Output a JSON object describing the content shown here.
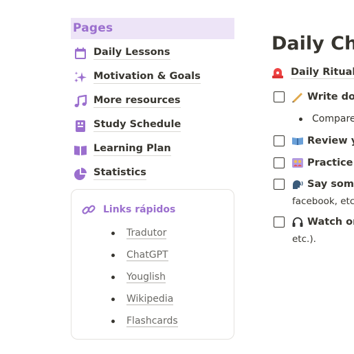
{
  "sidebar": {
    "header": "Pages",
    "items": [
      {
        "label": "Daily Lessons",
        "icon": "calendar-icon"
      },
      {
        "label": "Motivation & Goals",
        "icon": "sparkles-icon"
      },
      {
        "label": "More resources",
        "icon": "music-note-icon"
      },
      {
        "label": "Study Schedule",
        "icon": "schedule-icon"
      },
      {
        "label": "Learning Plan",
        "icon": "book-open-icon"
      },
      {
        "label": "Statistics",
        "icon": "pie-chart-icon"
      }
    ],
    "links": {
      "title": "Links rápidos",
      "icon": "link-icon",
      "items": [
        "Tradutor",
        "ChatGPT",
        "Youglish",
        "Wikipedia",
        "Flashcards"
      ]
    }
  },
  "main": {
    "title": "Daily Cha",
    "ritual": {
      "label": "Daily Ritual",
      "icon": "siren-icon"
    },
    "todos": [
      {
        "text": "Write dow",
        "icon": "writing-hand-icon"
      },
      {
        "text": "Review yo",
        "icon": "book-icon"
      },
      {
        "text": "Practice w",
        "icon": "people-icon"
      },
      {
        "text": "Say somet",
        "icon": "speaking-head-icon",
        "continuation": "facebook, etc"
      },
      {
        "text": "Watch or",
        "icon": "headphones-icon",
        "continuation": "etc.)."
      }
    ],
    "subitem": "Compare"
  },
  "colors": {
    "accent": "#9b6fce",
    "header_bg": "#ede4f7",
    "text": "#37352f"
  }
}
